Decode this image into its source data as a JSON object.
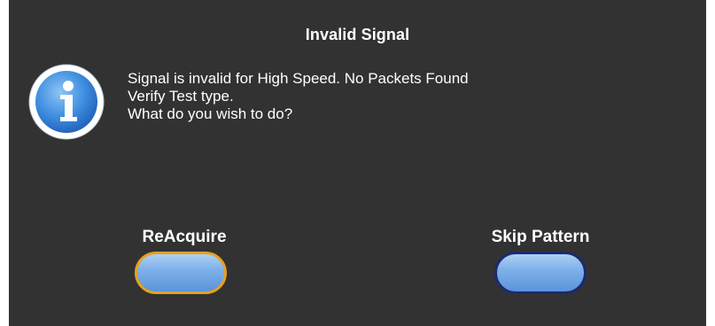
{
  "dialog": {
    "title": "Invalid Signal",
    "icon": "info-icon",
    "message_lines": [
      "Signal is invalid for High Speed. No Packets Found",
      "Verify Test type.",
      "What do you wish to do?"
    ]
  },
  "buttons": {
    "reacquire_label": "ReAcquire",
    "skip_label": "Skip Pattern"
  },
  "colors": {
    "background": "#323232",
    "text": "#ffffff",
    "focus_border": "#e6a020",
    "button_border": "#1c2a6e",
    "button_fill": "#7fb2ea"
  }
}
